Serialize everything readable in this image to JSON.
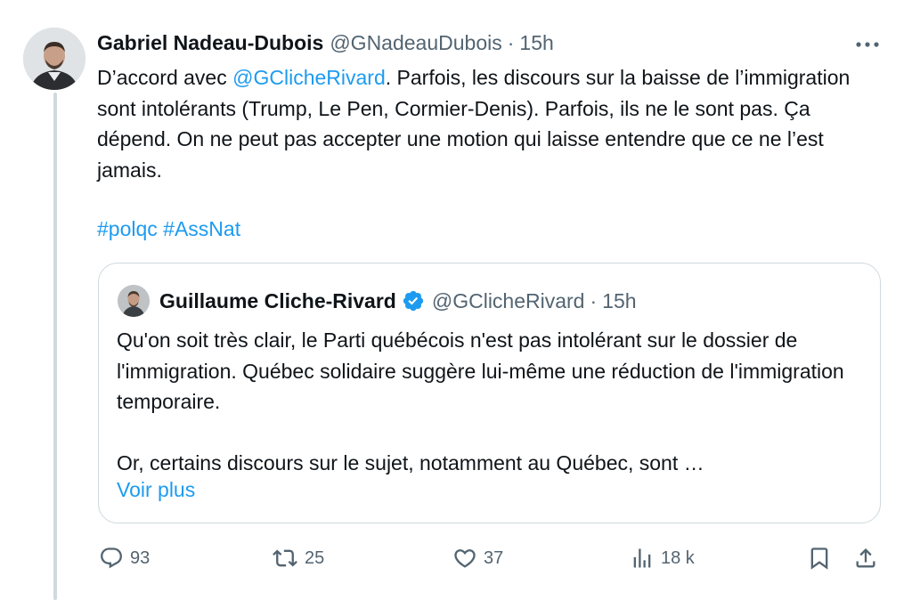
{
  "tweet": {
    "author_name": "Gabriel Nadeau-Dubois",
    "handle": "@GNadeauDubois",
    "separator": "·",
    "time": "15h",
    "text_before_mention": "D’accord avec ",
    "mention": "@GClicheRivard",
    "text_after_mention": ". Parfois, les discours sur la baisse de l’immigration sont intolérants (Trump, Le Pen, Cormier-Denis). Parfois, ils ne le sont pas. Ça dépend. On ne peut pas accepter une motion qui laisse entendre que ce ne l’est jamais.",
    "hashtags": [
      "#polqc",
      "#AssNat"
    ]
  },
  "quoted_tweet": {
    "author_name": "Guillaume Cliche-Rivard",
    "verified": true,
    "handle": "@GClicheRivard",
    "separator": "·",
    "time": "15h",
    "paragraph_1": "Qu'on soit très clair, le Parti québécois n'est pas intolérant sur le dossier de l'immigration. Québec solidaire suggère lui-même une réduction de l'immigration temporaire.",
    "paragraph_2": "Or, certains discours sur le sujet, notamment au Québec, sont …",
    "show_more": "Voir plus"
  },
  "actions": {
    "replies": "93",
    "reposts": "25",
    "likes": "37",
    "views": "18 k"
  },
  "icons": {
    "more": "more-horizontal-icon",
    "reply": "reply-icon",
    "repost": "repost-icon",
    "like": "heart-icon",
    "views": "views-icon",
    "bookmark": "bookmark-icon",
    "share": "share-icon",
    "verified": "verified-badge-icon"
  },
  "colors": {
    "link": "#1d9bf0",
    "secondary_text": "#536471",
    "border": "#cfd9de",
    "text": "#0f1419"
  }
}
